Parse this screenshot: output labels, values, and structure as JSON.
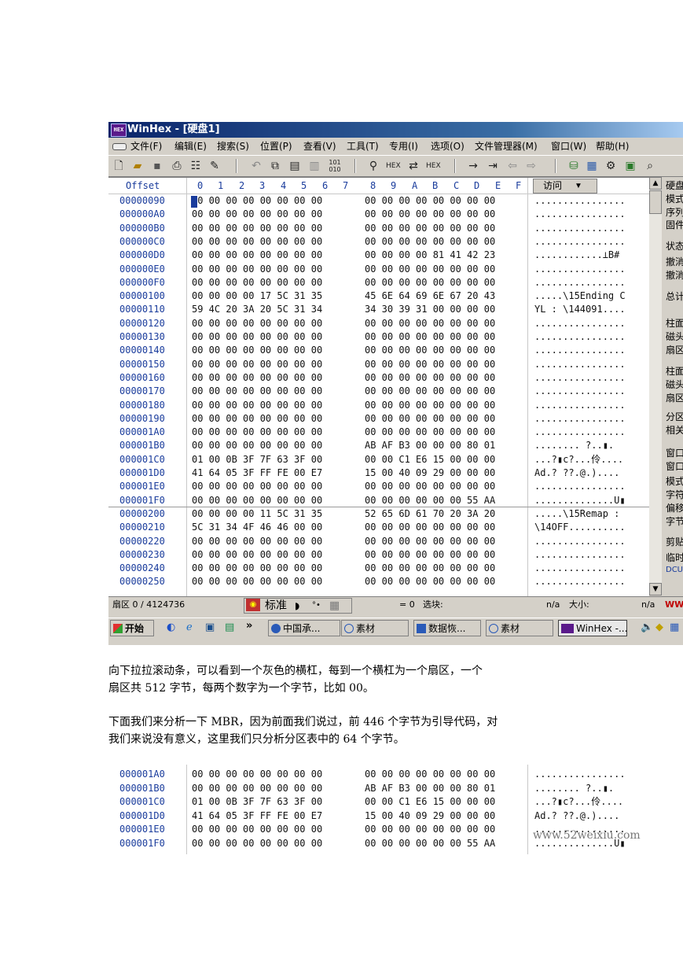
{
  "window": {
    "title": "WinHex - [硬盘1]"
  },
  "menu": [
    "文件(F)",
    "编辑(E)",
    "搜索(S)",
    "位置(P)",
    "查看(V)",
    "工具(T)",
    "专用(I)",
    "选项(O)",
    "文件管理器(M)",
    "窗口(W)",
    "帮助(H)"
  ],
  "toolbar_icons": [
    "new-icon",
    "open-icon",
    "save-icon",
    "print-icon",
    "properties-icon",
    "edit-icon",
    "undo-icon",
    "copy-icon",
    "paste-icon",
    "paste-special-icon",
    "binary-icon",
    "find-icon",
    "find-hex-icon",
    "replace-icon",
    "replace-hex-icon",
    "goto-icon",
    "goto-offset-icon",
    "back-icon",
    "forward-icon",
    "disk-icon",
    "ram-icon",
    "tools-icon",
    "calculator-icon",
    "zoom-icon"
  ],
  "hex_header": {
    "offset_label": "Offset",
    "columns": [
      "0",
      "1",
      "2",
      "3",
      "4",
      "5",
      "6",
      "7",
      "8",
      "9",
      "A",
      "B",
      "C",
      "D",
      "E",
      "F"
    ],
    "visit_label": "访问"
  },
  "hex_rows": [
    {
      "offset": "00000090",
      "h1": "00 00 00 00 00 00 00 00",
      "h2": "00 00 00 00 00 00 00 00",
      "ascii": "................"
    },
    {
      "offset": "000000A0",
      "h1": "00 00 00 00 00 00 00 00",
      "h2": "00 00 00 00 00 00 00 00",
      "ascii": "................"
    },
    {
      "offset": "000000B0",
      "h1": "00 00 00 00 00 00 00 00",
      "h2": "00 00 00 00 00 00 00 00",
      "ascii": "................"
    },
    {
      "offset": "000000C0",
      "h1": "00 00 00 00 00 00 00 00",
      "h2": "00 00 00 00 00 00 00 00",
      "ascii": "................"
    },
    {
      "offset": "000000D0",
      "h1": "00 00 00 00 00 00 00 00",
      "h2": "00 00 00 00 81 41 42 23",
      "ascii": "............⊥B#"
    },
    {
      "offset": "000000E0",
      "h1": "00 00 00 00 00 00 00 00",
      "h2": "00 00 00 00 00 00 00 00",
      "ascii": "................"
    },
    {
      "offset": "000000F0",
      "h1": "00 00 00 00 00 00 00 00",
      "h2": "00 00 00 00 00 00 00 00",
      "ascii": "................"
    },
    {
      "offset": "00000100",
      "h1": "00 00 00 00 17 5C 31 35",
      "h2": "45 6E 64 69 6E 67 20 43",
      "ascii": ".....\\15Ending C"
    },
    {
      "offset": "00000110",
      "h1": "59 4C 20 3A 20 5C 31 34",
      "h2": "34 30 39 31 00 00 00 00",
      "ascii": "YL : \\144091...."
    },
    {
      "offset": "00000120",
      "h1": "00 00 00 00 00 00 00 00",
      "h2": "00 00 00 00 00 00 00 00",
      "ascii": "................"
    },
    {
      "offset": "00000130",
      "h1": "00 00 00 00 00 00 00 00",
      "h2": "00 00 00 00 00 00 00 00",
      "ascii": "................"
    },
    {
      "offset": "00000140",
      "h1": "00 00 00 00 00 00 00 00",
      "h2": "00 00 00 00 00 00 00 00",
      "ascii": "................"
    },
    {
      "offset": "00000150",
      "h1": "00 00 00 00 00 00 00 00",
      "h2": "00 00 00 00 00 00 00 00",
      "ascii": "................"
    },
    {
      "offset": "00000160",
      "h1": "00 00 00 00 00 00 00 00",
      "h2": "00 00 00 00 00 00 00 00",
      "ascii": "................"
    },
    {
      "offset": "00000170",
      "h1": "00 00 00 00 00 00 00 00",
      "h2": "00 00 00 00 00 00 00 00",
      "ascii": "................"
    },
    {
      "offset": "00000180",
      "h1": "00 00 00 00 00 00 00 00",
      "h2": "00 00 00 00 00 00 00 00",
      "ascii": "................"
    },
    {
      "offset": "00000190",
      "h1": "00 00 00 00 00 00 00 00",
      "h2": "00 00 00 00 00 00 00 00",
      "ascii": "................"
    },
    {
      "offset": "000001A0",
      "h1": "00 00 00 00 00 00 00 00",
      "h2": "00 00 00 00 00 00 00 00",
      "ascii": "................"
    },
    {
      "offset": "000001B0",
      "h1": "00 00 00 00 00 00 00 00",
      "h2": "AB AF B3 00 00 00 80 01",
      "ascii": "........ ?..▮."
    },
    {
      "offset": "000001C0",
      "h1": "01 00 0B 3F 7F 63 3F 00",
      "h2": "00 00 C1 E6 15 00 00 00",
      "ascii": "...?▮c?...伶...."
    },
    {
      "offset": "000001D0",
      "h1": "41 64 05 3F FF FE 00 E7",
      "h2": "15 00 40 09 29 00 00 00",
      "ascii": "Ad.? ??.@.)...."
    },
    {
      "offset": "000001E0",
      "h1": "00 00 00 00 00 00 00 00",
      "h2": "00 00 00 00 00 00 00 00",
      "ascii": "................"
    },
    {
      "offset": "000001F0",
      "h1": "00 00 00 00 00 00 00 00",
      "h2": "00 00 00 00 00 00 55 AA",
      "ascii": "..............U▮"
    },
    {
      "offset": "00000200",
      "h1": "00 00 00 00 11 5C 31 35",
      "h2": "52 65 6D 61 70 20 3A 20",
      "ascii": ".....\\15Remap :"
    },
    {
      "offset": "00000210",
      "h1": "5C 31 34 4F 46 46 00 00",
      "h2": "00 00 00 00 00 00 00 00",
      "ascii": "\\14OFF.........."
    },
    {
      "offset": "00000220",
      "h1": "00 00 00 00 00 00 00 00",
      "h2": "00 00 00 00 00 00 00 00",
      "ascii": "................"
    },
    {
      "offset": "00000230",
      "h1": "00 00 00 00 00 00 00 00",
      "h2": "00 00 00 00 00 00 00 00",
      "ascii": "................"
    },
    {
      "offset": "00000240",
      "h1": "00 00 00 00 00 00 00 00",
      "h2": "00 00 00 00 00 00 00 00",
      "ascii": "................"
    },
    {
      "offset": "00000250",
      "h1": "00 00 00 00 00 00 00 00",
      "h2": "00 00 00 00 00 00 00 00",
      "ascii": "................"
    }
  ],
  "right_panel": [
    "硬盘",
    "模式",
    "序列",
    "固件",
    "状态",
    "撤消",
    "撤消",
    "总计",
    "柱面",
    "磁头",
    "扇区",
    "柱面",
    "磁头",
    "扇区",
    "分区",
    "相关",
    "窗口",
    "窗口",
    "模式",
    "字符",
    "偏移",
    "字节",
    "剪贴",
    "临时",
    "DCUM"
  ],
  "status": {
    "sector": "扇区 0 / 4124736",
    "ime_label": "标准",
    "offset_value": "= 0",
    "selection": "选块:",
    "na1": "n/a",
    "size_label": "大小:",
    "na2": "n/a",
    "www": "WW"
  },
  "taskbar": {
    "start": "开始",
    "more": "»",
    "items": [
      "中国承...",
      "素材",
      "数据恢...",
      "素材",
      "WinHex -..."
    ]
  },
  "paragraphs": [
    "向下拉拉滚动条，可以看到一个灰色的横杠，每到一个横杠为一个扇区，一个",
    "扇区共 512 字节，每两个数字为一个字节，比如 00。",
    "下面我们来分析一下 MBR，因为前面我们说过，前 446 个字节为引导代码，对",
    "我们来说没有意义，这里我们只分析分区表中的 64 个字节。"
  ],
  "detail_rows": [
    {
      "offset": "000001A0",
      "h1": "00 00 00 00 00 00 00 00",
      "h2": "00 00 00 00 00 00 00 00",
      "ascii": "................"
    },
    {
      "offset": "000001B0",
      "h1": "00 00 00 00 00 00 00 00",
      "h2": "AB AF B3 00 00 00 80 01",
      "ascii": "........ ?..▮."
    },
    {
      "offset": "000001C0",
      "h1": "01 00 0B 3F 7F 63 3F 00",
      "h2": "00 00 C1 E6 15 00 00 00",
      "ascii": "...?▮c?...伶...."
    },
    {
      "offset": "000001D0",
      "h1": "41 64 05 3F FF FE 00 E7",
      "h2": "15 00 40 09 29 00 00 00",
      "ascii": "Ad.? ??.@.)...."
    },
    {
      "offset": "000001E0",
      "h1": "00 00 00 00 00 00 00 00",
      "h2": "00 00 00 00 00 00 00 00",
      "ascii": "................"
    },
    {
      "offset": "000001F0",
      "h1": "00 00 00 00 00 00 00 00",
      "h2": "00 00 00 00 00 00 55 AA",
      "ascii": "..............U▮"
    }
  ],
  "watermark": "www.52weixiu.com"
}
